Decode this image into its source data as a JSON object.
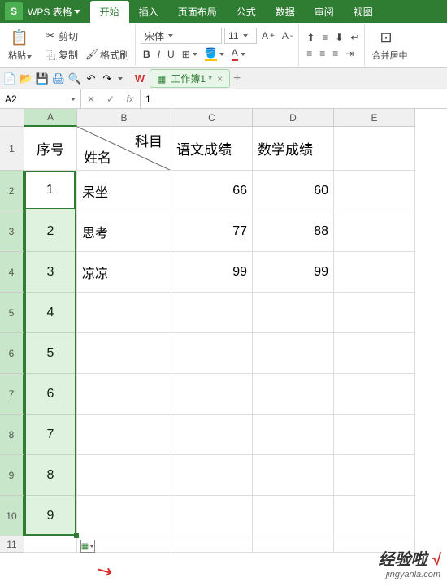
{
  "app": {
    "name": "WPS 表格"
  },
  "menu": {
    "items": [
      "开始",
      "插入",
      "页面布局",
      "公式",
      "数据",
      "审阅",
      "视图"
    ],
    "active_index": 0
  },
  "ribbon": {
    "paste": "粘贴",
    "cut": "剪切",
    "copy": "复制",
    "format_painter": "格式刷",
    "font_name": "宋体",
    "font_size": "11",
    "merge": "合并居中"
  },
  "doc_tab": {
    "icon": "W",
    "label": "工作簿1 *"
  },
  "formula_bar": {
    "name_box": "A2",
    "fx": "fx",
    "value": "1"
  },
  "columns": [
    {
      "letter": "A",
      "width": 65,
      "selected": true
    },
    {
      "letter": "B",
      "width": 116,
      "selected": false
    },
    {
      "letter": "C",
      "width": 100,
      "selected": false
    },
    {
      "letter": "D",
      "width": 100,
      "selected": false
    },
    {
      "letter": "E",
      "width": 100,
      "selected": false
    }
  ],
  "rows": [
    {
      "num": 1,
      "height": 54,
      "selected": false
    },
    {
      "num": 2,
      "height": 50,
      "selected": true
    },
    {
      "num": 3,
      "height": 50,
      "selected": true
    },
    {
      "num": 4,
      "height": 50,
      "selected": true
    },
    {
      "num": 5,
      "height": 50,
      "selected": true
    },
    {
      "num": 6,
      "height": 50,
      "selected": true
    },
    {
      "num": 7,
      "height": 50,
      "selected": true
    },
    {
      "num": 8,
      "height": 50,
      "selected": true
    },
    {
      "num": 9,
      "height": 50,
      "selected": true
    },
    {
      "num": 10,
      "height": 50,
      "selected": true
    },
    {
      "num": 11,
      "height": 20,
      "selected": false
    }
  ],
  "headers": {
    "A1": "序号",
    "B1_top": "科目",
    "B1_bottom": "姓名",
    "C1": "语文成绩",
    "D1": "数学成绩"
  },
  "data": {
    "A": [
      "1",
      "2",
      "3",
      "4",
      "5",
      "6",
      "7",
      "8",
      "9"
    ],
    "B": [
      "呆坐",
      "思考",
      "凉凉",
      "",
      "",
      "",
      "",
      "",
      ""
    ],
    "C": [
      "66",
      "77",
      "99",
      "",
      "",
      "",
      "",
      "",
      ""
    ],
    "D": [
      "60",
      "88",
      "99",
      "",
      "",
      "",
      "",
      "",
      ""
    ]
  },
  "selection": {
    "range": "A2:A10",
    "active": "A2",
    "active_value": "1"
  },
  "watermark": {
    "brand": "经验啦",
    "check": "√",
    "url": "jingyanla.com"
  },
  "chart_data": {
    "type": "table",
    "columns": [
      "序号",
      "姓名",
      "语文成绩",
      "数学成绩"
    ],
    "rows": [
      [
        1,
        "呆坐",
        66,
        60
      ],
      [
        2,
        "思考",
        77,
        88
      ],
      [
        3,
        "凉凉",
        99,
        99
      ]
    ]
  }
}
